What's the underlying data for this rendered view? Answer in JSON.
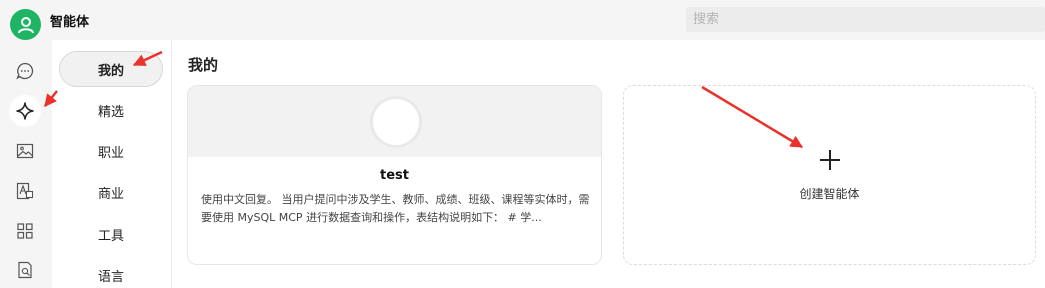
{
  "app": {
    "title": "智能体"
  },
  "search": {
    "placeholder": "搜索"
  },
  "rail": {
    "items": [
      {
        "icon": "chat-bubble-icon"
      },
      {
        "icon": "sparkle-icon",
        "active": true
      },
      {
        "icon": "image-icon"
      },
      {
        "icon": "text-image-icon"
      },
      {
        "icon": "apps-grid-icon"
      },
      {
        "icon": "document-search-icon"
      }
    ]
  },
  "categories": {
    "items": [
      {
        "label": "我的",
        "active": true
      },
      {
        "label": "精选"
      },
      {
        "label": "职业"
      },
      {
        "label": "商业"
      },
      {
        "label": "工具"
      },
      {
        "label": "语言"
      }
    ]
  },
  "main": {
    "section_title": "我的",
    "agent_card": {
      "name": "test",
      "description": "使用中文回复。 当用户提问中涉及学生、教师、成绩、班级、课程等实体时，需要使用 MySQL MCP 进行数据查询和操作，表结构说明如下： # 学..."
    },
    "create_card": {
      "label": "创建智能体"
    }
  },
  "colors": {
    "brand": "#1fb463",
    "annotation_arrow": "#e8322b"
  }
}
